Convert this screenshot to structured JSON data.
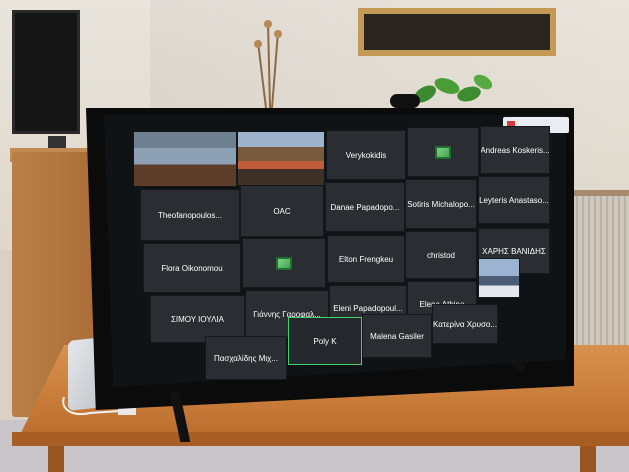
{
  "meeting": {
    "participants": [
      {
        "name": "",
        "kind": "video-conference-room"
      },
      {
        "name": "",
        "kind": "video-conference-room"
      },
      {
        "name": "Verykokidis"
      },
      {
        "name": "",
        "kind": "app-icon"
      },
      {
        "name": "Andreas Koskeris..."
      },
      {
        "name": "Theofanopoulos..."
      },
      {
        "name": "OAC"
      },
      {
        "name": "Danae Papadopo..."
      },
      {
        "name": "Sotiris Michalopo..."
      },
      {
        "name": "Leyteris Anastaso..."
      },
      {
        "name": "Flora Oikonomou"
      },
      {
        "name": "",
        "kind": "app-icon"
      },
      {
        "name": "Elton Frengkeu"
      },
      {
        "name": "christod"
      },
      {
        "name": "ΧΑΡΗΣ ΒΑΝΙΔΗΣ"
      },
      {
        "name": "ΣΙΜΟΥ ΙΟΥΛΙΑ"
      },
      {
        "name": "Γιάννης Γαροφαλ..."
      },
      {
        "name": "Eleni Papadopoul..."
      },
      {
        "name": "Elena Athina"
      },
      {
        "name": "",
        "kind": "landscape-photo"
      },
      {
        "name": "Πασχαλίδης Μιχ..."
      },
      {
        "name": "Poly K",
        "active": true
      },
      {
        "name": "Malena Gasiler"
      },
      {
        "name": "Κατερίνα Χρυσο..."
      }
    ]
  },
  "colors": {
    "tile": "#2a2d31",
    "active_border": "#44d16c",
    "text": "#ffffff",
    "table": "#c77a38"
  }
}
